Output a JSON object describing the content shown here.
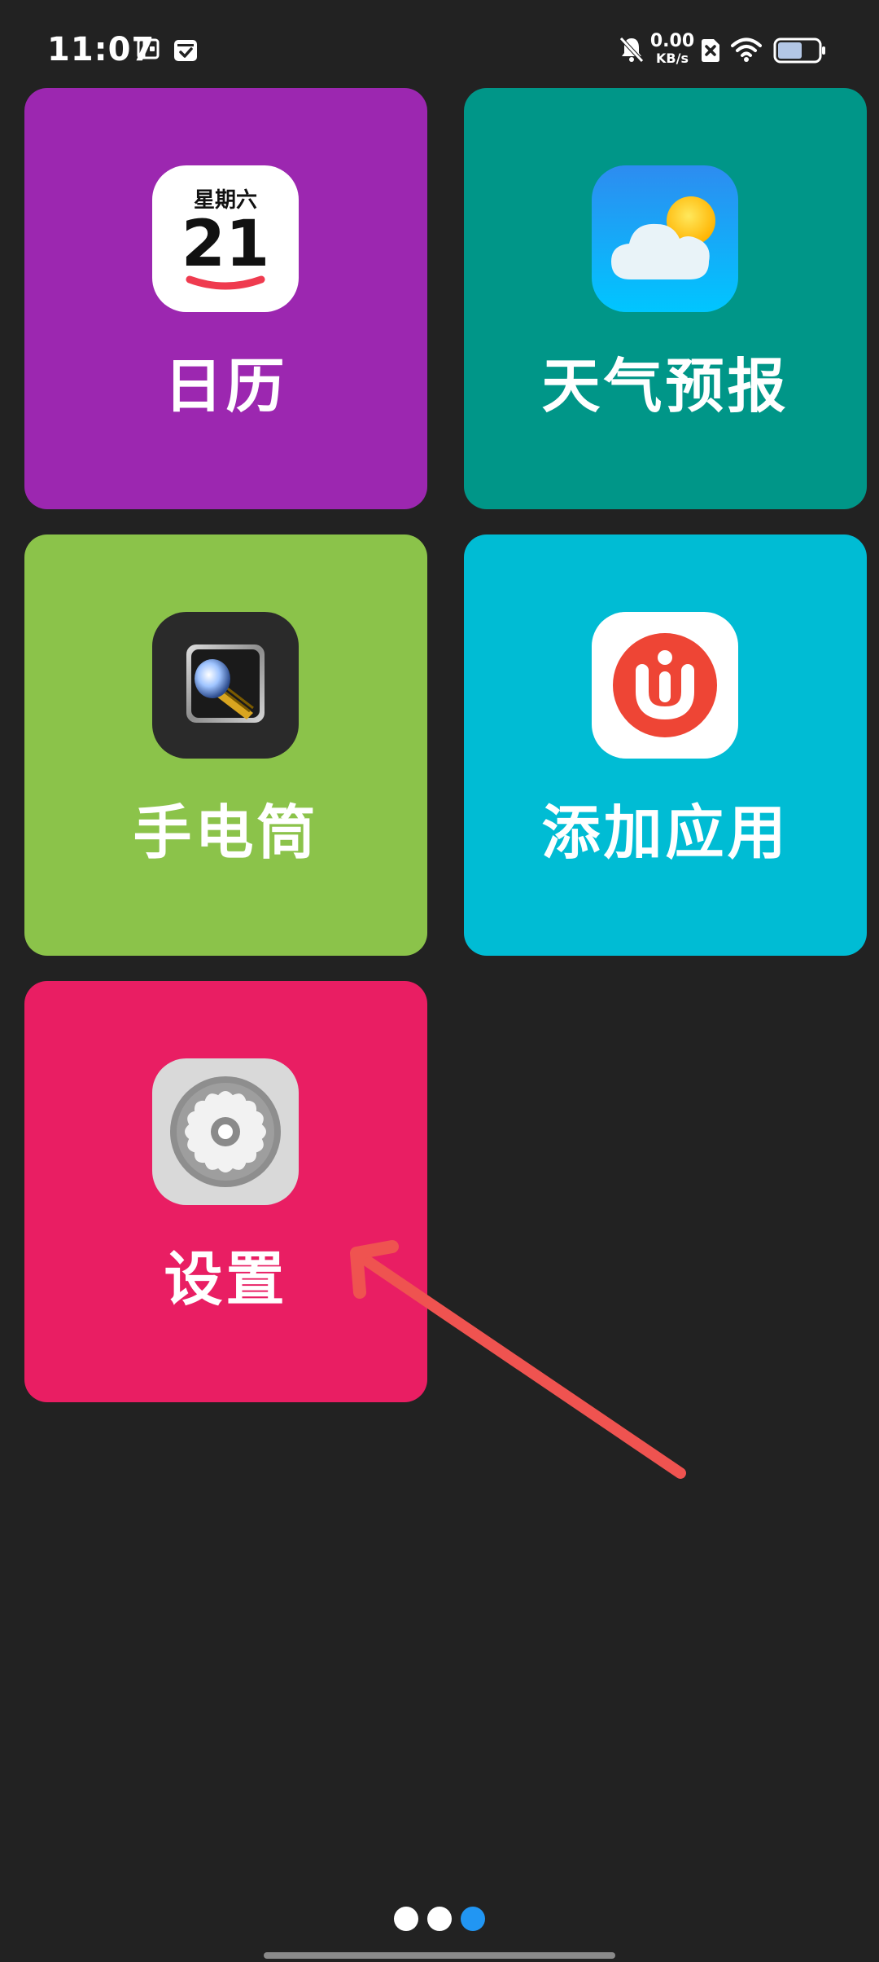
{
  "status_bar": {
    "time": "11:07",
    "net_speed_value": "0.00",
    "net_speed_unit": "KB/s",
    "battery_level": 0.6,
    "icons": [
      "wallet-icon",
      "calendar-check-icon",
      "mute-bell-icon",
      "no-sim-icon",
      "wifi-icon",
      "battery-icon"
    ]
  },
  "tiles": [
    {
      "label": "日历",
      "icon": "calendar-icon",
      "color": "#9c27b0",
      "icon_weekday": "星期六",
      "icon_day": "21"
    },
    {
      "label": "天气预报",
      "icon": "weather-icon",
      "color": "#009688"
    },
    {
      "label": "手电筒",
      "icon": "flashlight-icon",
      "color": "#8bc34a"
    },
    {
      "label": "添加应用",
      "icon": "add-app-icon",
      "color": "#00bcd4"
    },
    {
      "label": "设置",
      "icon": "settings-icon",
      "color": "#e91e63"
    }
  ],
  "pager": {
    "pages": 3,
    "current": 3,
    "active_color": "#2196f3",
    "inactive_color": "#ffffff"
  },
  "annotation": {
    "icon": "arrow-annotation-icon",
    "color": "#ef5350"
  }
}
